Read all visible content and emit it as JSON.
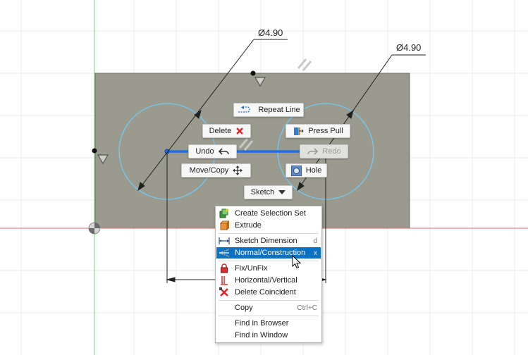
{
  "dimensions": {
    "left_diameter": "Ø4.90",
    "right_diameter": "Ø4.90"
  },
  "marking_menu": {
    "repeat": "Repeat Line",
    "delete": "Delete",
    "press_pull": "Press Pull",
    "undo": "Undo",
    "redo": "Redo",
    "move_copy": "Move/Copy",
    "hole": "Hole",
    "sketch": "Sketch"
  },
  "context_menu": {
    "items": [
      {
        "label": "Create Selection Set",
        "shortcut": ""
      },
      {
        "label": "Extrude",
        "shortcut": ""
      },
      {
        "label": "Sketch Dimension",
        "shortcut": "d"
      },
      {
        "label": "Normal/Construction",
        "shortcut": "x",
        "highlighted": true
      },
      {
        "label": "Fix/UnFix",
        "shortcut": ""
      },
      {
        "label": "Horizontal/Vertical",
        "shortcut": ""
      },
      {
        "label": "Delete Coincident",
        "shortcut": ""
      },
      {
        "label": "Copy",
        "shortcut": "Ctrl+C"
      },
      {
        "label": "Find in Browser",
        "shortcut": ""
      },
      {
        "label": "Find in Window",
        "shortcut": ""
      }
    ]
  },
  "colors": {
    "sketch_fill": "#9a9a8e",
    "profile_circle": "#7cc3e6",
    "selected_line": "#1a73e0",
    "x_axis": "#e06a6a",
    "y_axis": "#6ed86e",
    "menu_highlight": "#0a72c4"
  }
}
